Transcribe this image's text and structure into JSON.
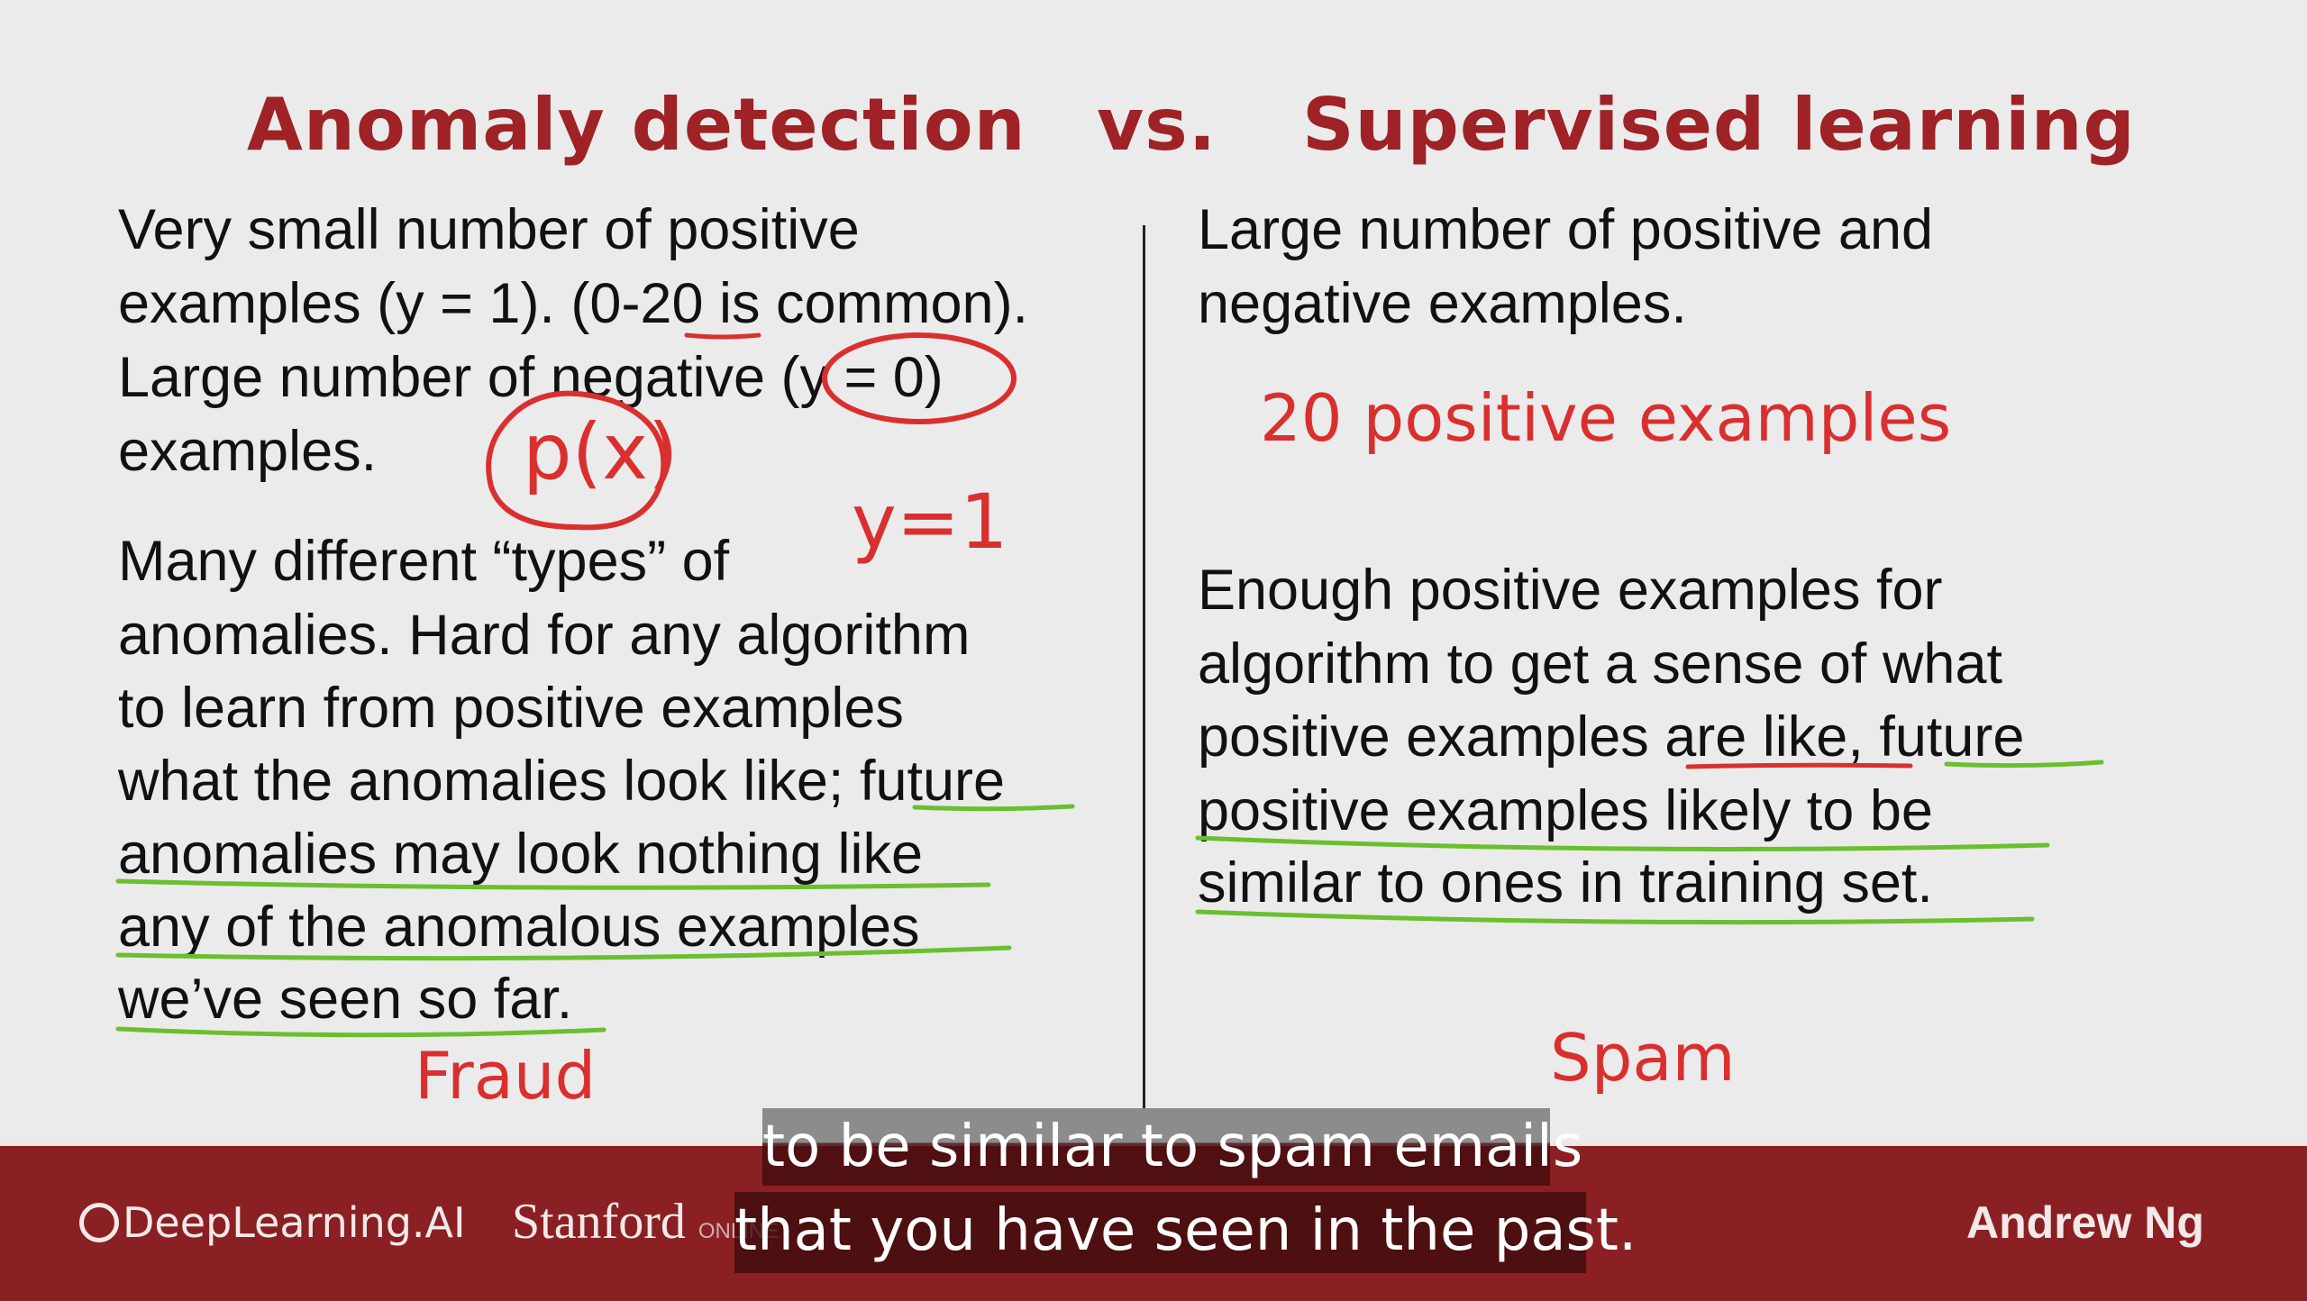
{
  "title": {
    "left": "Anomaly detection",
    "vs": "vs.",
    "right": "Supervised learning"
  },
  "left_column": {
    "lines": [
      "Very small number of positive",
      "examples (y = 1). (0-20 is common).",
      "Large number of negative (y = 0)",
      "examples.",
      "Many different “types” of",
      "anomalies. Hard for any algorithm",
      "to learn from positive examples",
      "what the anomalies look like; future",
      "anomalies may look nothing like",
      "any of the anomalous examples",
      "we’ve seen so far."
    ]
  },
  "right_column": {
    "lines": [
      "Large number of positive and",
      "negative examples.",
      "Enough positive examples for",
      "algorithm to get a sense of what",
      "positive examples are like,  future",
      "positive examples likely to be",
      "similar to ones in training set."
    ]
  },
  "annotations": {
    "px": "p(x)",
    "y1": "y=1",
    "twenty_positive": "20 positive examples",
    "fraud": "Fraud",
    "spam": "Spam"
  },
  "footer": {
    "brand": "DeepLearning.AI",
    "stanford": "Stanford",
    "online": "ONLINE",
    "instructor": "Andrew Ng"
  },
  "captions": [
    "to be similar to spam emails",
    "that you have seen in the past."
  ],
  "colors": {
    "title": "#9e2226",
    "annotation_red": "#d9302f",
    "annotation_green": "#6abf2e",
    "band": "#8a2023"
  }
}
